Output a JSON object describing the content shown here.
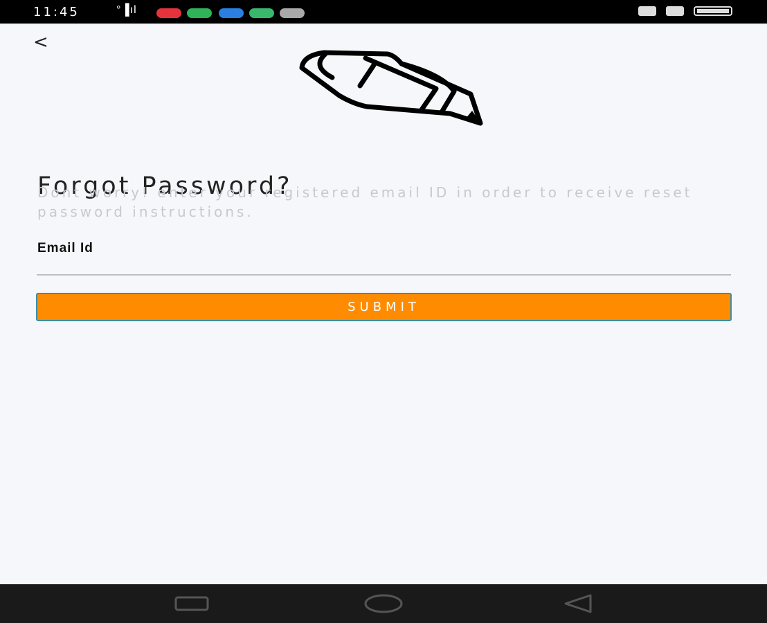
{
  "status_bar": {
    "time": "11:45",
    "signal_text": "°▐ıl",
    "battery_icon": "battery-icon"
  },
  "header": {
    "back_label": "<"
  },
  "main": {
    "illustration_icon": "pencil-icon",
    "title": "Forgot Password?",
    "subtitle": "Dont worry! enter your registered email ID in order to receive reset password instructions.",
    "email_label": "Email Id",
    "email_value": "",
    "email_placeholder": "",
    "submit_label": "SUBMIT"
  },
  "nav_bar": {
    "recent_icon": "recent-apps-icon",
    "home_icon": "home-circle-icon",
    "back_icon": "back-triangle-icon"
  },
  "colors": {
    "accent": "#ff8c00",
    "button_border": "#3c8ea8",
    "background": "#f6f7fb"
  }
}
